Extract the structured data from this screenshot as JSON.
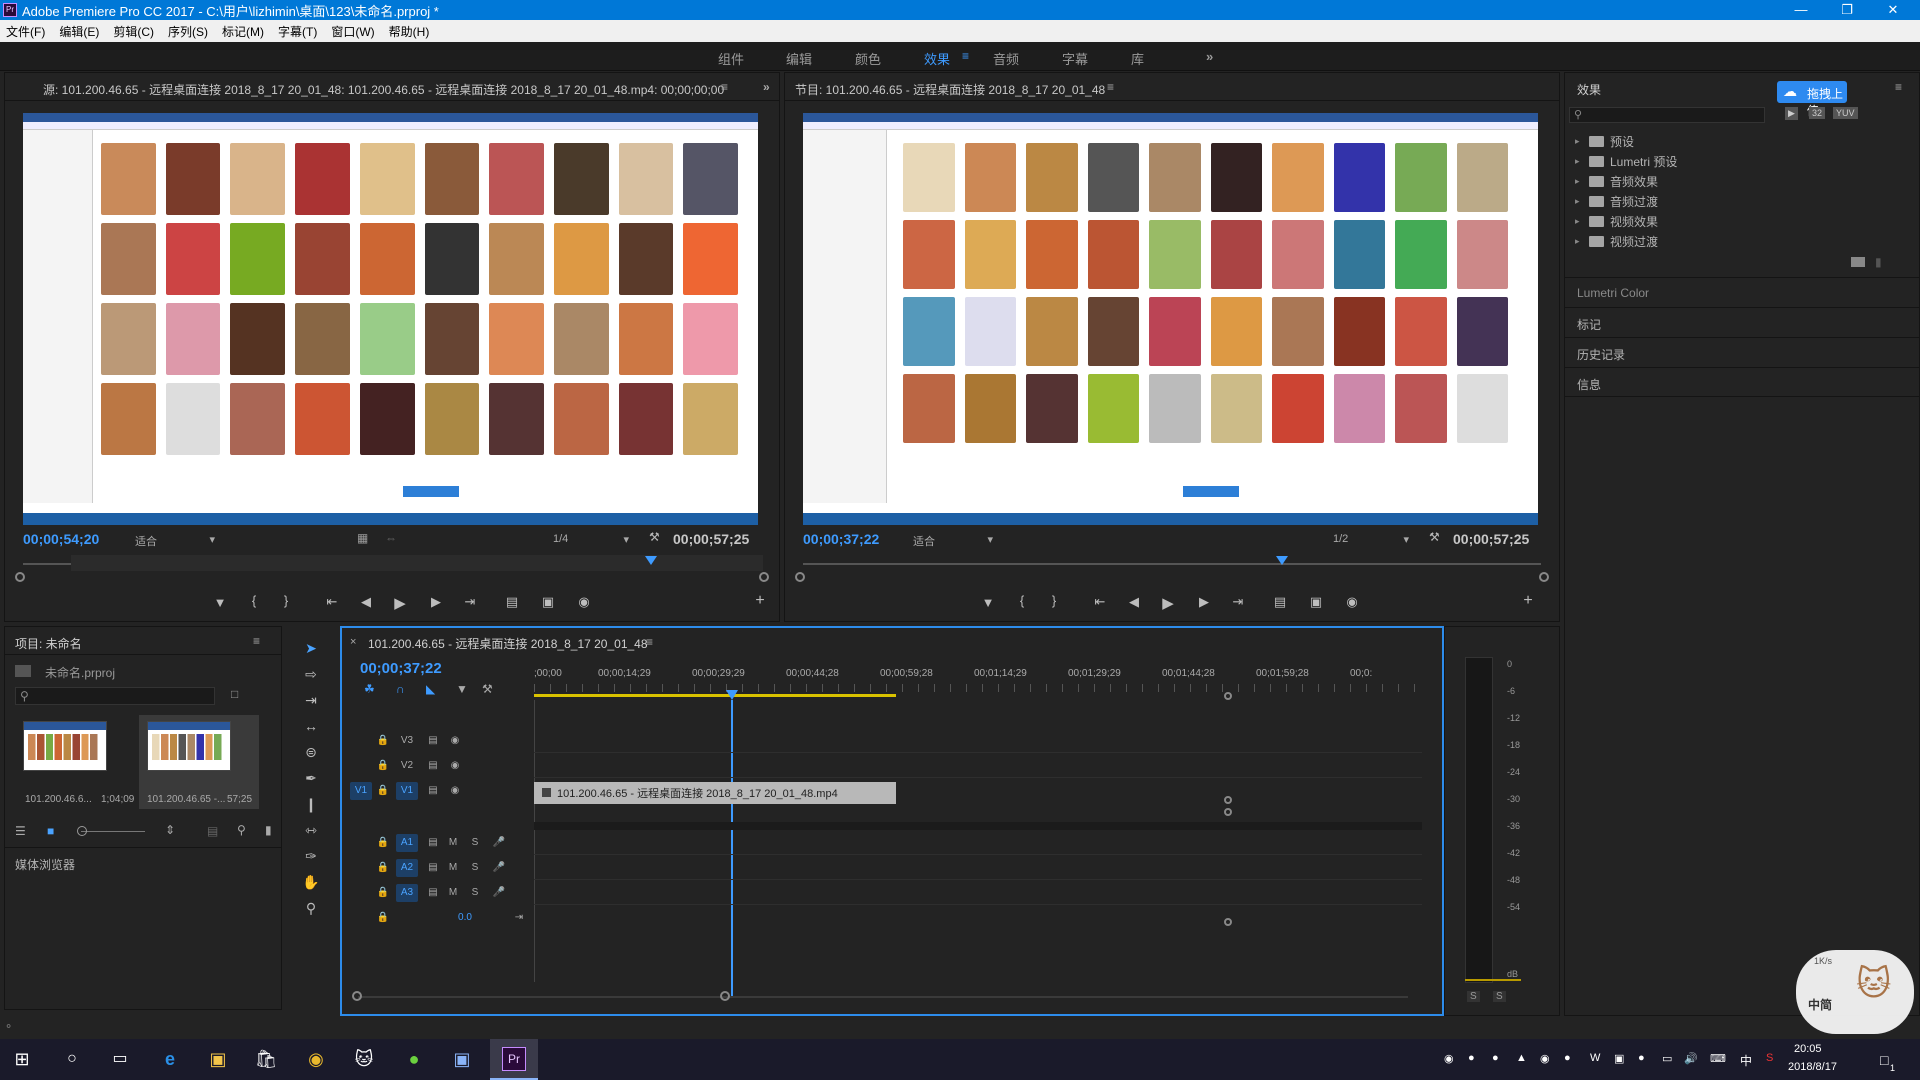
{
  "window": {
    "title": "Adobe Premiere Pro CC 2017 - C:\\用户\\lizhimin\\桌面\\123\\未命名.prproj *",
    "logo": "Pr"
  },
  "menu": [
    "文件(F)",
    "编辑(E)",
    "剪辑(C)",
    "序列(S)",
    "标记(M)",
    "字幕(T)",
    "窗口(W)",
    "帮助(H)"
  ],
  "workspaces": [
    "组件",
    "编辑",
    "颜色",
    "效果",
    "音频",
    "字幕",
    "库"
  ],
  "active_workspace": "效果",
  "source": {
    "title": "源: 101.200.46.65 - 远程桌面连接 2018_8_17 20_01_48: 101.200.46.65 - 远程桌面连接 2018_8_17  20_01_48.mp4: 00;00;00;00",
    "timecode": "00;00;54;20",
    "fit": "适合",
    "ratio": "1/4",
    "duration": "00;00;57;25"
  },
  "program": {
    "title": "节目: 101.200.46.65 - 远程桌面连接 2018_8_17 20_01_48",
    "timecode": "00;00;37;22",
    "fit": "适合",
    "ratio": "1/2",
    "duration": "00;00;57;25"
  },
  "project": {
    "title": "项目: 未命名",
    "file": "未命名.prproj",
    "clips": [
      {
        "name": "101.200.46.6...",
        "dur": "1;04;09"
      },
      {
        "name": "101.200.46.65 -...",
        "dur": "57;25"
      }
    ],
    "media_browser": "媒体浏览器"
  },
  "timeline": {
    "tab": "101.200.46.65 - 远程桌面连接 2018_8_17 20_01_48",
    "timecode": "00;00;37;22",
    "ruler": [
      ";00;00",
      "00;00;14;29",
      "00;00;29;29",
      "00;00;44;28",
      "00;00;59;28",
      "00;01;14;29",
      "00;01;29;29",
      "00;01;44;28",
      "00;01;59;28",
      "00;0:"
    ],
    "video_tracks": [
      "V3",
      "V2",
      "V1"
    ],
    "audio_tracks": [
      "A1",
      "A2",
      "A3"
    ],
    "src_patch": "V1",
    "mix_value": "0.0",
    "clip": "101.200.46.65 - 远程桌面连接 2018_8_17  20_01_48.mp4",
    "mute": "M",
    "solo": "S"
  },
  "meter": {
    "scale": [
      "0",
      "-6",
      "-12",
      "-18",
      "-24",
      "-30",
      "-36",
      "-42",
      "-48",
      "-54",
      "dB"
    ],
    "buttons": [
      "S",
      "S"
    ]
  },
  "effects": {
    "title": "效果",
    "upload": "拖拽上传",
    "folders": [
      "预设",
      "Lumetri 预设",
      "音频效果",
      "音频过渡",
      "视频效果",
      "视频过渡"
    ],
    "badges": [
      "32",
      "YUV"
    ],
    "sections": [
      "Lumetri Color",
      "标记",
      "历史记录",
      "信息"
    ]
  },
  "overlay": {
    "speed": "1K/s",
    "ime": "中简"
  },
  "tray": {
    "time": "20:05",
    "date": "2018/8/17",
    "lang": "中",
    "notif": "1"
  }
}
